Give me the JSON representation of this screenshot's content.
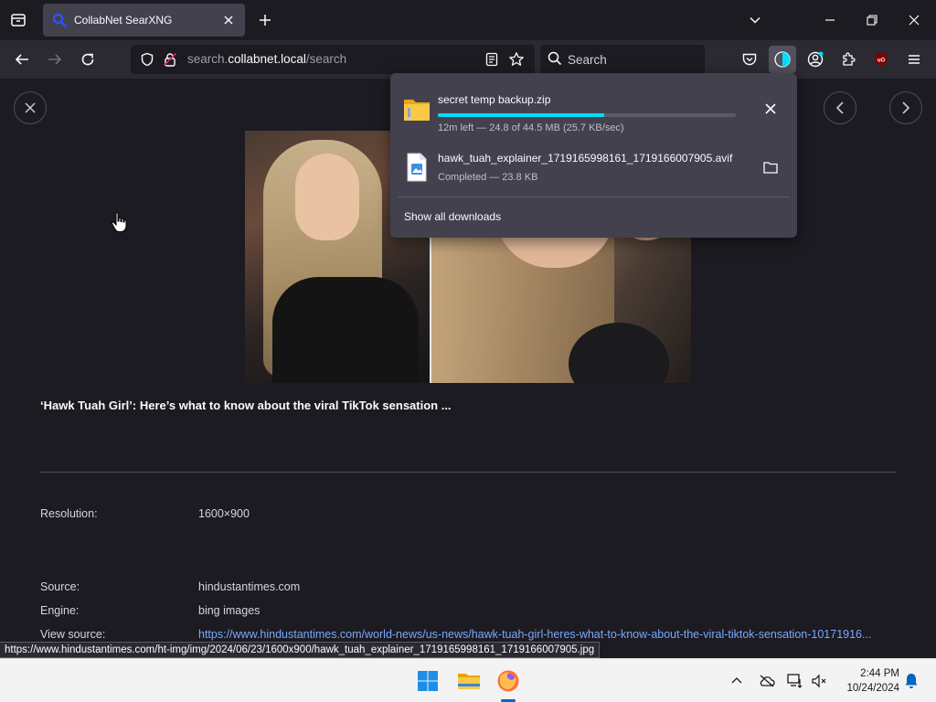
{
  "browser": {
    "tab": {
      "title": "CollabNet SearXNG"
    },
    "url": {
      "prefix": "search.",
      "host": "collabnet.local",
      "path": "/search"
    },
    "search": {
      "placeholder": "Search"
    }
  },
  "page": {
    "headline": "‘Hawk Tuah Girl’: Here’s what to know about the viral TikTok sensation ...",
    "details": [
      {
        "label": "Resolution:",
        "value": "1600×900"
      },
      {
        "label": "Source:",
        "value": "hindustantimes.com"
      },
      {
        "label": "Engine:",
        "value": "bing images"
      },
      {
        "label": "View source:",
        "value": "https://www.hindustantimes.com/world-news/us-news/hawk-tuah-girl-heres-what-to-know-about-the-viral-tiktok-sensation-10171916..."
      }
    ]
  },
  "status_url": "https://www.hindustantimes.com/ht-img/img/2024/06/23/1600x900/hawk_tuah_explainer_1719165998161_1719166007905.jpg",
  "downloads": {
    "items": [
      {
        "name": "secret temp backup.zip",
        "status": "12m left — 24.8 of 44.5 MB (25.7 KB/sec)",
        "progress": 0.557
      },
      {
        "name": "hawk_tuah_explainer_1719165998161_1719166007905.avif",
        "status": "Completed — 23.8 KB"
      }
    ],
    "show_all_label": "Show all downloads"
  },
  "taskbar": {
    "time": "2:44 PM",
    "date": "10/24/2024"
  },
  "colors": {
    "accent": "#00ddff",
    "link": "#7aa7ff",
    "background": "#1c1b22"
  }
}
